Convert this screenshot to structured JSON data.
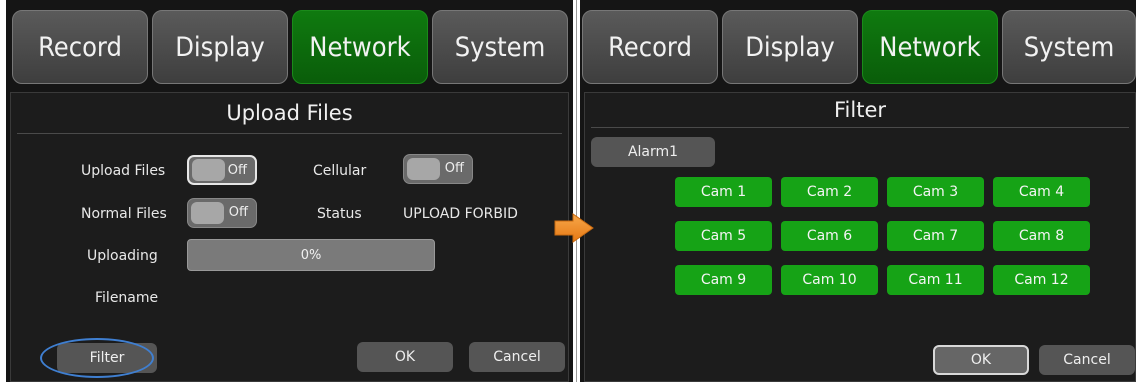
{
  "tabs": [
    "Record",
    "Display",
    "Network",
    "System"
  ],
  "active_tab": "Network",
  "left": {
    "title": "Upload Files",
    "upload_files_label": "Upload Files",
    "upload_files_value": "Off",
    "cellular_label": "Cellular",
    "cellular_value": "Off",
    "normal_files_label": "Normal Files",
    "normal_files_value": "Off",
    "status_label": "Status",
    "status_value": "UPLOAD FORBID",
    "uploading_label": "Uploading",
    "progress_text": "0%",
    "progress_value": 0,
    "filename_label": "Filename",
    "filter_button": "Filter",
    "ok_button": "OK",
    "cancel_button": "Cancel"
  },
  "right": {
    "title": "Filter",
    "alarm_button": "Alarm1",
    "cams": [
      "Cam 1",
      "Cam 2",
      "Cam 3",
      "Cam 4",
      "Cam 5",
      "Cam 6",
      "Cam 7",
      "Cam 8",
      "Cam 9",
      "Cam 10",
      "Cam 11",
      "Cam 12"
    ],
    "ok_button": "OK",
    "cancel_button": "Cancel"
  },
  "colors": {
    "active_tab": "#0a6b0a",
    "cam_button": "#16a316",
    "highlight_ring": "#3f7fd1",
    "arrow": "#f08a24"
  },
  "icons": {
    "transition": "arrow-right-icon"
  }
}
